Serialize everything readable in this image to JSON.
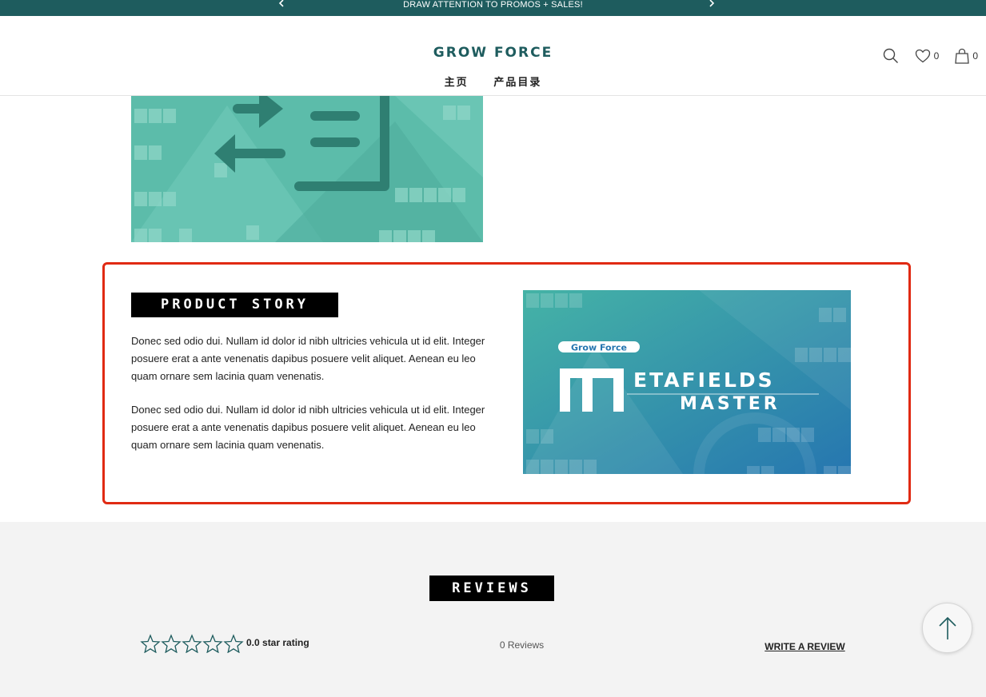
{
  "promo": {
    "text": "DRAW ATTENTION TO PROMOS + SALES!",
    "prev_icon": "chevron-left-icon",
    "next_icon": "chevron-right-icon"
  },
  "header": {
    "logo": "GROW FORCE",
    "nav": [
      {
        "label": "主页"
      },
      {
        "label": "产品目录"
      }
    ],
    "icons": {
      "search": "search-icon",
      "wishlist": "heart-icon",
      "cart": "bag-icon"
    },
    "wishlist_count": "0",
    "cart_count": "0"
  },
  "story": {
    "heading": "PRODUCT STORY",
    "paragraphs": [
      "Donec sed odio dui. Nullam id dolor id nibh ultricies vehicula ut id elit. Integer posuere erat a ante venenatis dapibus posuere velit aliquet. Aenean eu leo quam ornare sem lacinia quam venenatis.",
      "Donec sed odio dui. Nullam id dolor id nibh ultricies vehicula ut id elit. Integer posuere erat a ante venenatis dapibus posuere velit aliquet. Aenean eu leo quam ornare sem lacinia quam venenatis."
    ],
    "banner": {
      "brand": "Grow Force",
      "title_line1": "ETAFIELDS",
      "title_line2": "MASTER"
    }
  },
  "reviews": {
    "heading": "REVIEWS",
    "rating_value": 0.0,
    "rating_text": "0.0 star rating",
    "count_text": "0 Reviews",
    "write_label": "WRITE A REVIEW"
  },
  "colors": {
    "brand": "#1e5c5e",
    "highlight_border": "#e02a13",
    "teal_image": "#5cbcaa",
    "blue_image": "#2a8fb0"
  }
}
